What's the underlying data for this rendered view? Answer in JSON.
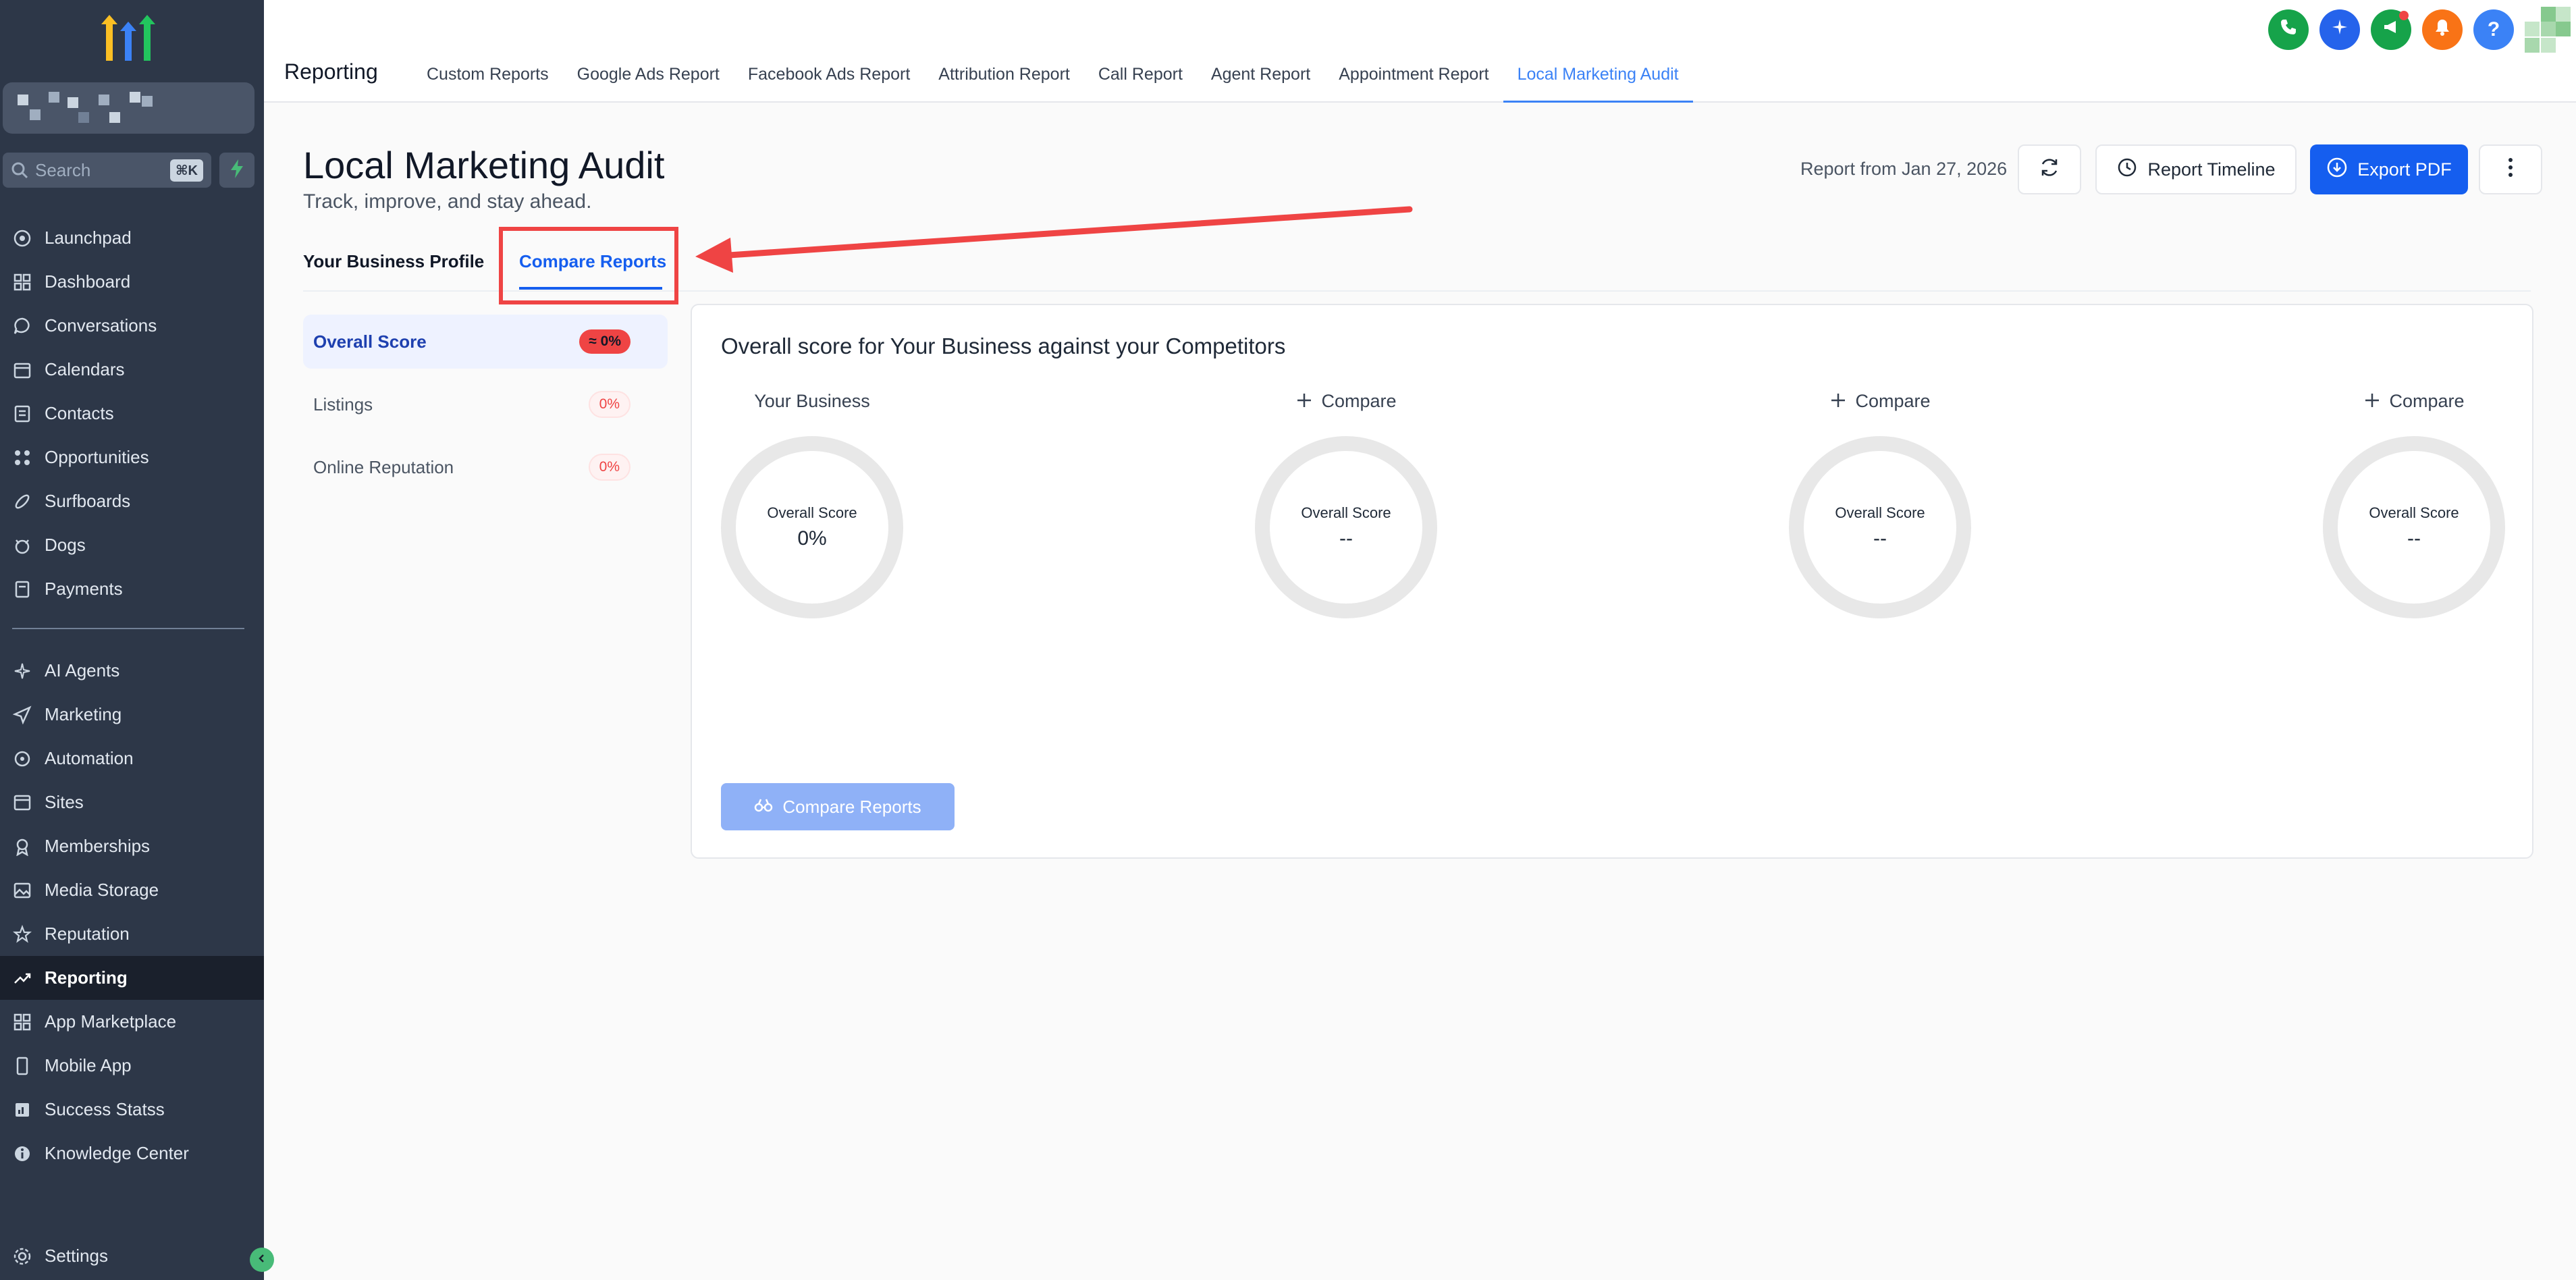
{
  "sidebar": {
    "search_placeholder": "Search",
    "search_shortcut": "⌘K",
    "items": [
      {
        "label": "Launchpad",
        "icon": "rocket-icon"
      },
      {
        "label": "Dashboard",
        "icon": "grid-icon"
      },
      {
        "label": "Conversations",
        "icon": "chat-icon"
      },
      {
        "label": "Calendars",
        "icon": "calendar-icon"
      },
      {
        "label": "Contacts",
        "icon": "contacts-icon"
      },
      {
        "label": "Opportunities",
        "icon": "opportunities-icon"
      },
      {
        "label": "Surfboards",
        "icon": "surfboard-icon"
      },
      {
        "label": "Dogs",
        "icon": "dog-icon"
      },
      {
        "label": "Payments",
        "icon": "payments-icon"
      }
    ],
    "items2": [
      {
        "label": "AI Agents",
        "icon": "sparkle-icon"
      },
      {
        "label": "Marketing",
        "icon": "send-icon"
      },
      {
        "label": "Automation",
        "icon": "automation-icon"
      },
      {
        "label": "Sites",
        "icon": "sites-icon"
      },
      {
        "label": "Memberships",
        "icon": "membership-icon"
      },
      {
        "label": "Media Storage",
        "icon": "image-icon"
      },
      {
        "label": "Reputation",
        "icon": "star-icon"
      },
      {
        "label": "Reporting",
        "icon": "trend-icon"
      },
      {
        "label": "App Marketplace",
        "icon": "apps-icon"
      },
      {
        "label": "Mobile App",
        "icon": "mobile-icon"
      },
      {
        "label": "Success Statss",
        "icon": "stats-icon"
      },
      {
        "label": "Knowledge Center",
        "icon": "info-icon"
      }
    ],
    "settings_label": "Settings"
  },
  "topbar": {
    "title": "Reporting",
    "tabs": [
      "Custom Reports",
      "Google Ads Report",
      "Facebook Ads Report",
      "Attribution Report",
      "Call Report",
      "Agent Report",
      "Appointment Report",
      "Local Marketing Audit"
    ],
    "active_tab": "Local Marketing Audit",
    "help_label": "?"
  },
  "page": {
    "title": "Local Marketing Audit",
    "subtitle": "Track, improve, and stay ahead.",
    "report_date": "Report from Jan 27, 2026",
    "report_timeline_label": "Report Timeline",
    "export_label": "Export PDF",
    "sub_tabs": [
      "Your Business Profile",
      "Compare Reports"
    ]
  },
  "left_menu": [
    {
      "label": "Overall Score",
      "badge": "≈ 0%"
    },
    {
      "label": "Listings",
      "badge": "0%"
    },
    {
      "label": "Online Reputation",
      "badge": "0%"
    }
  ],
  "card": {
    "title": "Overall score for Your Business against your Competitors",
    "columns": [
      {
        "heading": "Your Business",
        "label": "Overall Score",
        "value": "0%"
      },
      {
        "heading": "Compare",
        "label": "Overall Score",
        "value": "--"
      },
      {
        "heading": "Compare",
        "label": "Overall Score",
        "value": "--"
      },
      {
        "heading": "Compare",
        "label": "Overall Score",
        "value": "--"
      }
    ],
    "compare_button": "Compare Reports"
  },
  "colors": {
    "sidebar_bg": "#2d3748",
    "accent": "#155eef",
    "annotation": "#ef4444"
  }
}
